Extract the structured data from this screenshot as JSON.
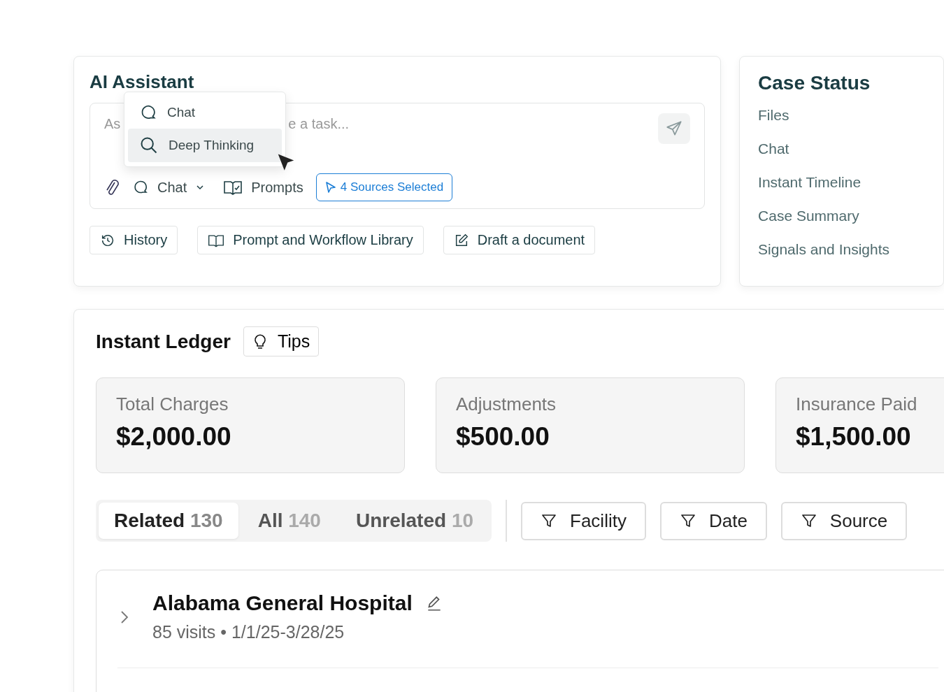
{
  "assistant": {
    "title": "AI Assistant",
    "placeholder": [
      "As",
      "e a task..."
    ],
    "toolbar": {
      "mode": "Chat",
      "prompts": "Prompts",
      "sources": "4 Sources Selected"
    },
    "menu": [
      {
        "label": "Chat",
        "kind": "chat",
        "selected": false
      },
      {
        "label": "Deep Thinking",
        "kind": "search",
        "selected": true
      }
    ],
    "actions": [
      {
        "label": "History",
        "kind": "history"
      },
      {
        "label": "Prompt and Workflow Library",
        "kind": "book"
      },
      {
        "label": "Draft a document",
        "kind": "edit"
      }
    ]
  },
  "case_status": {
    "title": "Case Status",
    "items": [
      "Files",
      "Chat",
      "Instant Timeline",
      "Case Summary",
      "Signals and Insights"
    ]
  },
  "ledger": {
    "title": "Instant Ledger",
    "tips": "Tips",
    "cards": [
      {
        "label": "Total Charges",
        "value": "$2,000.00"
      },
      {
        "label": "Adjustments",
        "value": "$500.00"
      },
      {
        "label": "Insurance Paid",
        "value": "$1,500.00"
      }
    ],
    "tabs": [
      {
        "label": "Related",
        "count": "130",
        "selected": true
      },
      {
        "label": "All",
        "count": "140",
        "selected": false
      },
      {
        "label": "Unrelated",
        "count": "10",
        "selected": false
      }
    ],
    "filters": [
      "Facility",
      "Date",
      "Source"
    ],
    "rows": [
      {
        "name": "Alabama General Hospital",
        "detail": "85 visits • 1/1/25-3/28/25",
        "expanded": false
      }
    ]
  }
}
